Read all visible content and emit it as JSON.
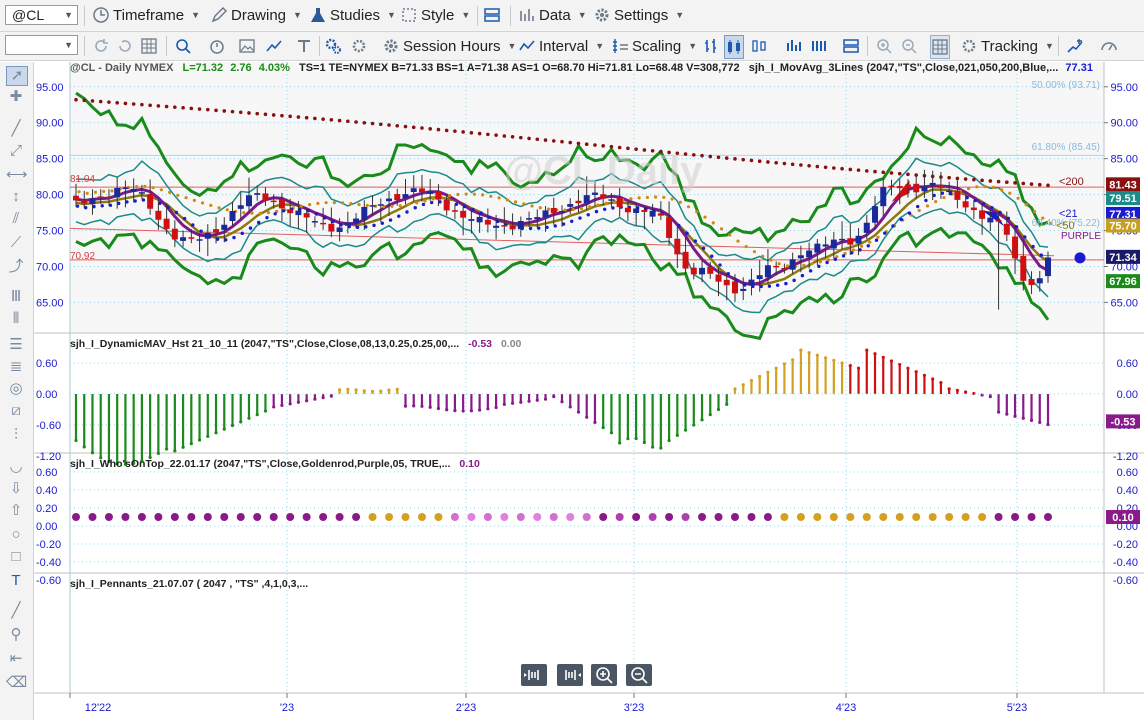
{
  "toolbar": {
    "symbol": "@CL",
    "timeframe": "Timeframe",
    "drawing": "Drawing",
    "studies": "Studies",
    "style": "Style",
    "data": "Data",
    "settings": "Settings",
    "session_hours": "Session Hours",
    "interval": "Interval",
    "scaling": "Scaling",
    "tracking": "Tracking"
  },
  "main_pane": {
    "header": {
      "symbol_info": "@CL - Daily  NYMEX",
      "last": "L=71.32",
      "change": "2.76",
      "pct": "4.03%",
      "rest": "TS=1  TE=NYMEX  B=71.33  BS=1  A=71.38  AS=1  O=68.70  Hi=71.81  Lo=68.48  V=308,772",
      "study": "sjh_I_MovAvg_3Lines (2047,\"TS\",Close,021,050,200,Blue,...",
      "study_value": "77.31"
    },
    "watermark": "@CL Daily",
    "fib_labels": [
      "50.00% (93.71)",
      "61.80% (85.45)",
      "68.40% (75.22)"
    ],
    "price_ticks": [
      "95.00",
      "90.00",
      "85.00",
      "80.00",
      "75.00",
      "70.00",
      "65.00"
    ],
    "left_labels": [
      "81.04",
      "70.92"
    ],
    "line_labels": [
      "<200",
      "<21",
      "<50",
      "PURPLE"
    ],
    "price_badges": [
      "81.43",
      "79.51",
      "77.31",
      "75.70",
      "71.34",
      "67.96"
    ]
  },
  "pane2": {
    "header": "sjh_I_DynamicMAV_Hst 21_10_11 (2047,\"TS\",Close,Close,08,13,0.25,0.25,00,...",
    "v1": "-0.53",
    "v2": "0.00",
    "ticks": [
      "0.60",
      "0.00",
      "-0.60",
      "-1.20"
    ],
    "badge": "-0.53"
  },
  "pane3": {
    "header": "sjh_I_Who'sOnTop_22.01.17 (2047,\"TS\",Close,Goldenrod,Purple,05, TRUE,...",
    "v1": "0.10",
    "ticks": [
      "0.60",
      "0.40",
      "0.20",
      "0.00",
      "-0.20",
      "-0.40",
      "-0.60"
    ],
    "badge": "0.10"
  },
  "pane4": {
    "header": "sjh_I_Pennants_21.07.07 ( 2047 , \"TS\" ,4,1,0,3,..."
  },
  "x_axis": [
    "12'22",
    "'23",
    "2'23",
    "3'23",
    "4'23",
    "5'23"
  ],
  "colors": {
    "green": "#1a8a1a",
    "purple": "#7a1a8a",
    "olive": "#8a7a10",
    "teal": "#1a8a8a",
    "blue_dots": "#1a1ad0",
    "orange_dots": "#d08a10",
    "maroon_dots": "#8a1010",
    "up_candle": "#1a2a9a",
    "down_candle": "#d01010"
  },
  "chart_data": {
    "type": "candlestick",
    "close_series_recent": [
      {
        "x": "04/28",
        "close": 76.8
      },
      {
        "x": "05/01",
        "close": 75.7
      },
      {
        "x": "05/02",
        "close": 71.7
      },
      {
        "x": "05/03",
        "close": 68.6
      },
      {
        "x": "05/04",
        "close": 68.6
      },
      {
        "x": "05/05",
        "close": 71.3
      }
    ],
    "ylim": [
      62.0,
      96.5
    ]
  }
}
